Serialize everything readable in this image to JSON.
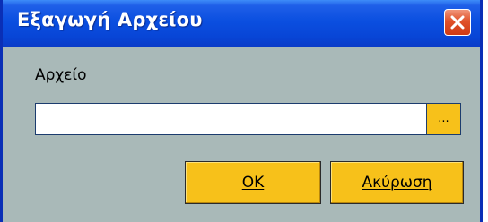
{
  "window": {
    "title": "Εξαγωγή Αρχείου",
    "close_icon": "close-icon"
  },
  "file": {
    "label": "Αρχείο",
    "value": "",
    "placeholder": "",
    "browse_label": "..."
  },
  "buttons": {
    "ok_label": "OK",
    "cancel_label": "Ακύρωση"
  },
  "colors": {
    "titlebar": "#0b4fe0",
    "body": "#a9b9b8",
    "button": "#f7c11a",
    "close": "#e0522a"
  }
}
